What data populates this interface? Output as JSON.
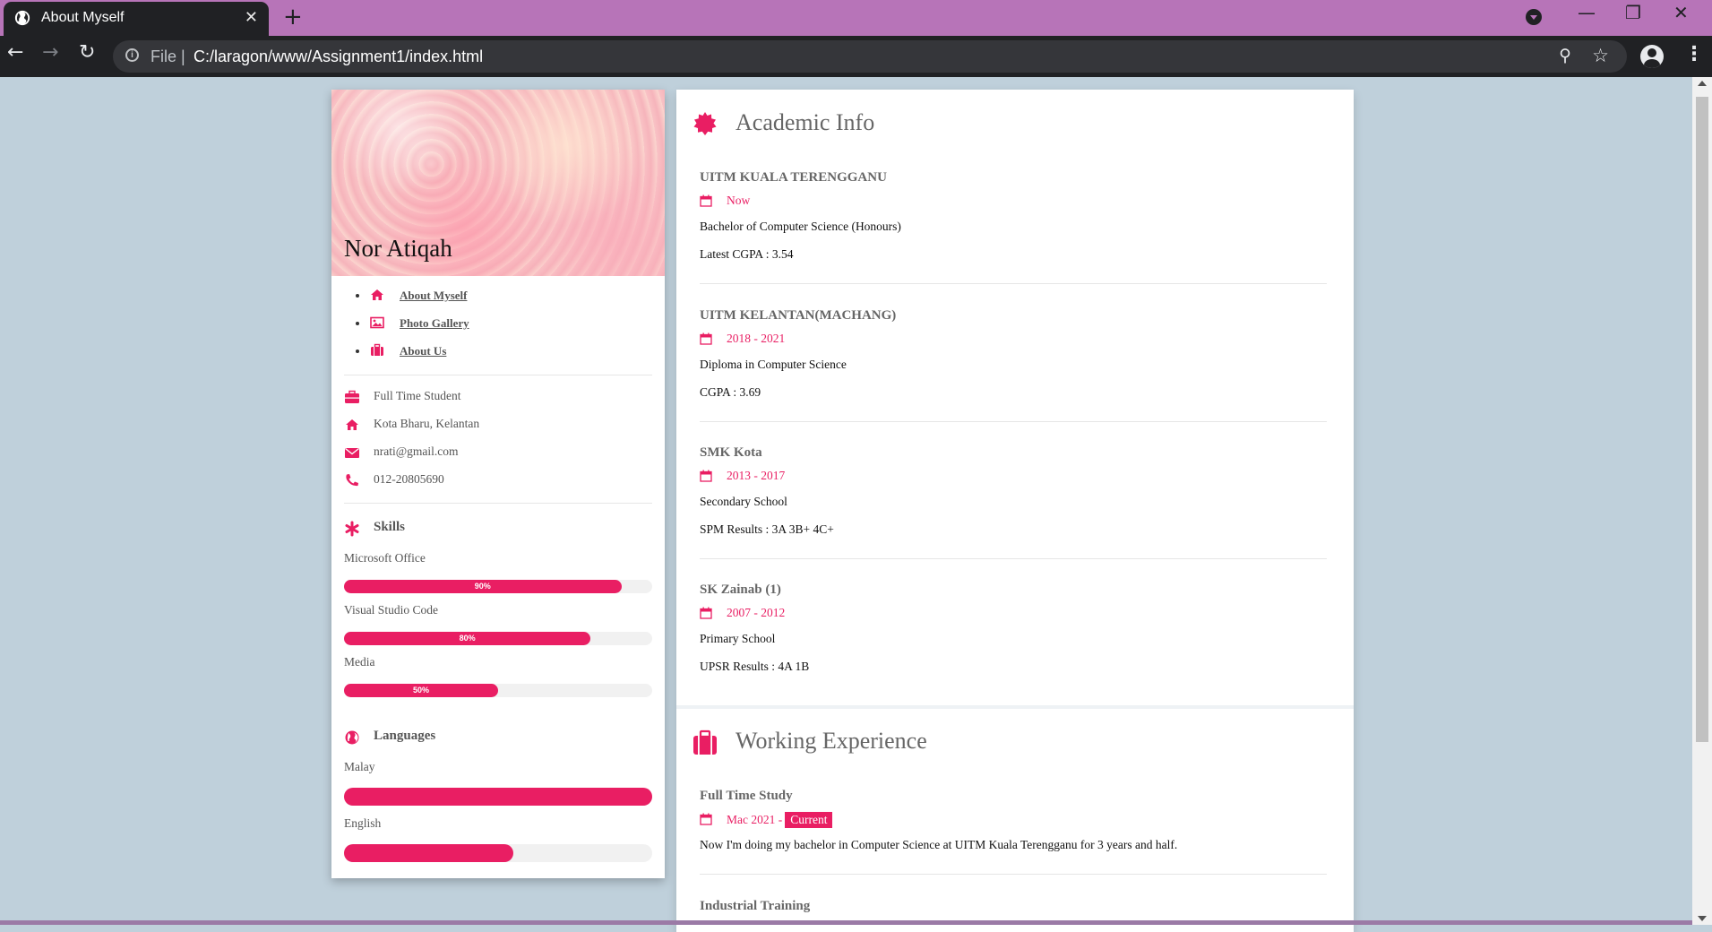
{
  "browser": {
    "tab_title": "About Myself",
    "tab_close": "✕",
    "new_tab": "+",
    "address_scheme": "File",
    "address_sep": "|",
    "url": "C:/laragon/www/Assignment1/index.html",
    "win_min": "—",
    "win_restore": "❐",
    "win_close": "✕",
    "back": "←",
    "forward": "→",
    "reload": "↻",
    "zoom_icon": "⚲",
    "star_icon": "☆",
    "menu_icon": "⋮"
  },
  "profile": {
    "name": "Nor Atiqah",
    "nav": [
      {
        "label": "About Myself",
        "icon": "home-icon"
      },
      {
        "label": "Photo Gallery",
        "icon": "image-icon"
      },
      {
        "label": "About Us",
        "icon": "suitcase-icon"
      }
    ],
    "info": [
      {
        "text": "Full Time Student",
        "icon": "briefcase-icon"
      },
      {
        "text": "Kota Bharu, Kelantan",
        "icon": "home-icon"
      },
      {
        "text": "nrati@gmail.com",
        "icon": "envelope-icon"
      },
      {
        "text": "012-20805690",
        "icon": "phone-icon"
      }
    ],
    "skills_title": "Skills",
    "skills": [
      {
        "name": "Microsoft Office",
        "label": "90%",
        "percent": 90
      },
      {
        "name": "Visual Studio Code",
        "label": "80%",
        "percent": 80
      },
      {
        "name": "Media",
        "label": "50%",
        "percent": 50
      }
    ],
    "languages_title": "Languages",
    "languages": [
      {
        "name": "Malay",
        "percent": 100
      },
      {
        "name": "English",
        "percent": 55
      }
    ]
  },
  "academic": {
    "title": "Academic Info",
    "entries": [
      {
        "institution": "UITM KUALA TERENGGANU",
        "date": "Now",
        "line1": "Bachelor of Computer Science (Honours)",
        "line2": "Latest CGPA : 3.54"
      },
      {
        "institution": "UITM KELANTAN(MACHANG)",
        "date": "2018 - 2021",
        "line1": "Diploma in Computer Science",
        "line2": "CGPA : 3.69"
      },
      {
        "institution": "SMK Kota",
        "date": "2013 - 2017",
        "line1": "Secondary School",
        "line2": "SPM Results : 3A 3B+ 4C+"
      },
      {
        "institution": "SK Zainab (1)",
        "date": "2007 - 2012",
        "line1": "Primary School",
        "line2": "UPSR Results : 4A 1B"
      }
    ]
  },
  "work": {
    "title": "Working Experience",
    "entries": [
      {
        "title": "Full Time Study",
        "date": "Mac 2021 -",
        "badge": "Current",
        "desc": "Now I'm doing my bachelor in Computer Science at UITM Kuala Terengganu for 3 years and half."
      },
      {
        "title": "Industrial Training"
      }
    ]
  },
  "colors": {
    "accent": "#e91e63",
    "page_bg": "#bfd0db",
    "tabbar": "#b774b8",
    "chrome_dark": "#202124"
  }
}
